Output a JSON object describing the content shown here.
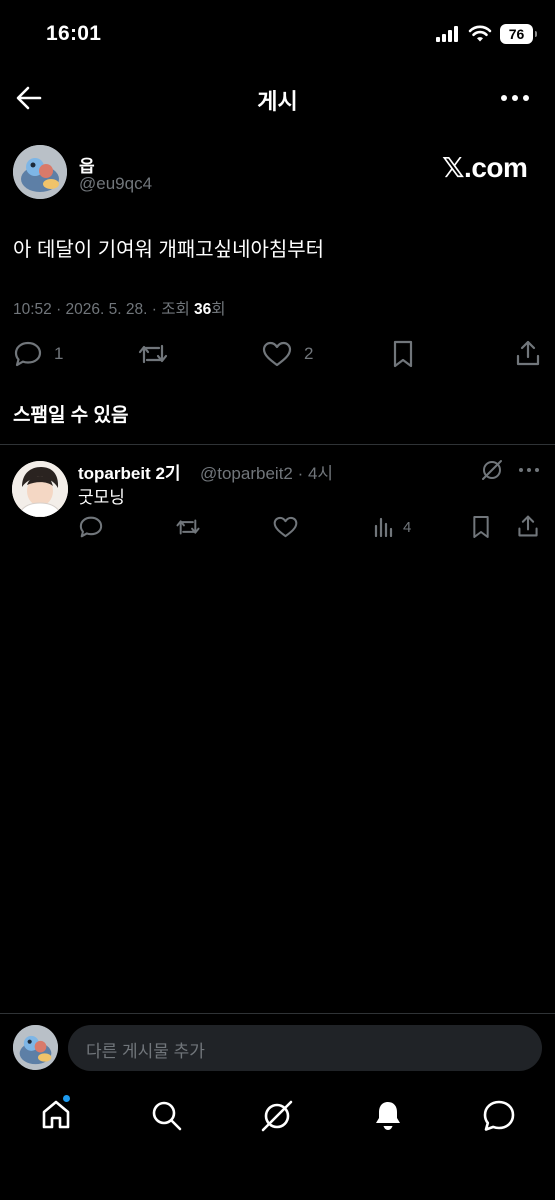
{
  "status_bar": {
    "time": "16:01",
    "battery": "76"
  },
  "header": {
    "title": "게시"
  },
  "post": {
    "author_name": "읍",
    "author_handle": "@eu9qc4",
    "watermark": "𝕏.com",
    "text": "아 데달이 기여워 개패고싶네아침부터",
    "meta_prefix": "10:52 · 2026. 5. 28. · 조회 ",
    "views": "36",
    "meta_suffix": "회",
    "replies": "1",
    "likes": "2"
  },
  "spam_note": "스팸일 수 있음",
  "reply": {
    "name": "toparbeit 2기",
    "handle_time": "@toparbeit2 · 4시",
    "text": "굿모닝",
    "views": "4"
  },
  "composer": {
    "placeholder": "다른 게시물 추가"
  },
  "colors": {
    "background": "#000000",
    "text": "#e7e9ea",
    "muted": "#71767b",
    "accent": "#1d9bf0",
    "divider": "#2f3336"
  },
  "icons": [
    "back-arrow-icon",
    "more-icon",
    "reply-icon",
    "repost-icon",
    "like-icon",
    "bookmark-icon",
    "share-icon",
    "grok-icon",
    "views-icon",
    "home-icon",
    "search-icon",
    "notifications-icon",
    "messages-icon"
  ]
}
